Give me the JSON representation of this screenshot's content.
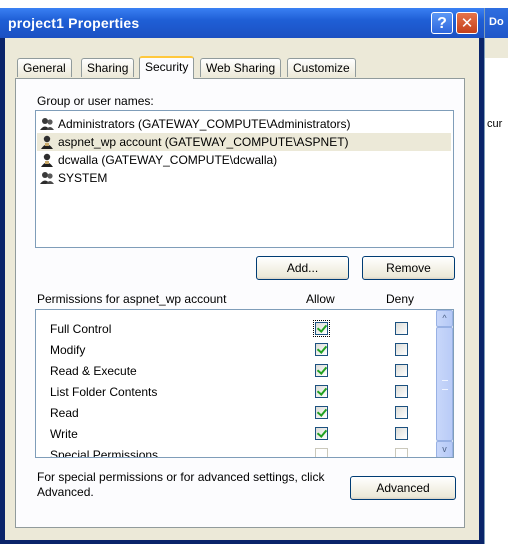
{
  "background_window": {
    "title_fragment": "Do",
    "text_fragment": "cur"
  },
  "window": {
    "title": "project1 Properties"
  },
  "title_buttons": {
    "help": "?",
    "close": "✕"
  },
  "tabs": [
    "General",
    "Sharing",
    "Security",
    "Web Sharing",
    "Customize"
  ],
  "active_tab": "Security",
  "group_label": "Group or user names:",
  "users": [
    {
      "name": "Administrators (GATEWAY_COMPUTE\\Administrators)",
      "icon": "group-icon",
      "selected": false
    },
    {
      "name": "aspnet_wp account (GATEWAY_COMPUTE\\ASPNET)",
      "icon": "user-icon",
      "selected": true
    },
    {
      "name": "dcwalla (GATEWAY_COMPUTE\\dcwalla)",
      "icon": "user-icon",
      "selected": false
    },
    {
      "name": "SYSTEM",
      "icon": "group-icon",
      "selected": false
    }
  ],
  "buttons": {
    "add": "Add...",
    "remove": "Remove",
    "advanced": "Advanced"
  },
  "permissions": {
    "label": "Permissions for aspnet_wp account",
    "allow_header": "Allow",
    "deny_header": "Deny",
    "rows": [
      {
        "name": "Full Control",
        "allow": true,
        "deny": false
      },
      {
        "name": "Modify",
        "allow": true,
        "deny": false
      },
      {
        "name": "Read & Execute",
        "allow": true,
        "deny": false
      },
      {
        "name": "List Folder Contents",
        "allow": true,
        "deny": false
      },
      {
        "name": "Read",
        "allow": true,
        "deny": false
      },
      {
        "name": "Write",
        "allow": true,
        "deny": false
      },
      {
        "name": "Special Permissions",
        "allow": false,
        "deny": false
      }
    ]
  },
  "advanced_note": "For special permissions or for advanced settings, click Advanced.",
  "scroll_arrows": {
    "up": "^",
    "down": "v"
  },
  "colors": {
    "titlebar": "#1f5fd6",
    "dialog_bg": "#ece9d8",
    "selection": "#ece9d8",
    "check": "#21a121"
  }
}
